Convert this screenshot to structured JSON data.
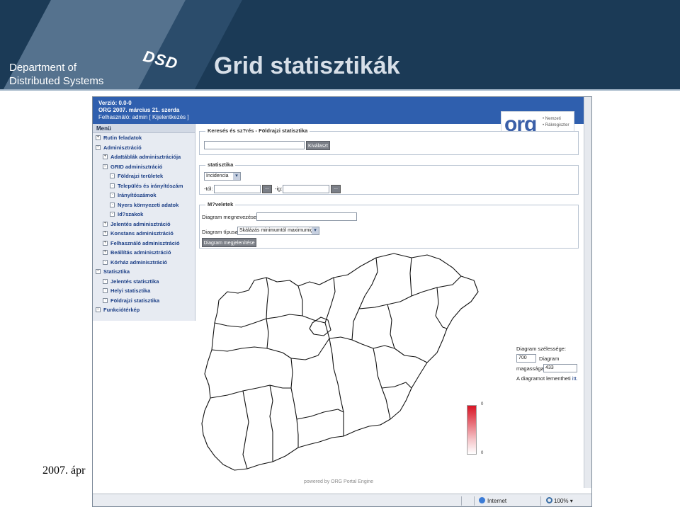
{
  "slide": {
    "dept_line1": "Department of",
    "dept_line2": "Distributed Systems",
    "logo_text": "DSD",
    "title": "Grid statisztikák",
    "footer_date": "2007. ápr"
  },
  "app": {
    "version": "Verzió: 0.0-0",
    "date_line": "ORG 2007. március 21. szerda",
    "user_line": "Felhasználó: admin [ Kijelentkezés ]",
    "logo_org": "org",
    "logo_sub1": "• Nemzeti",
    "logo_sub2": "• Rákregiszter"
  },
  "menu": {
    "header": "Menü",
    "items": [
      {
        "toggle": "+",
        "label": "Rutin feladatok",
        "indent": 0
      },
      {
        "toggle": "−",
        "label": "Adminisztráció",
        "indent": 0
      },
      {
        "toggle": "+",
        "label": "Adattáblák adminisztrációja",
        "indent": 1
      },
      {
        "toggle": "−",
        "label": "GRID adminisztráció",
        "indent": 1
      },
      {
        "toggle": "·",
        "label": "Földrajzi területek",
        "indent": 2
      },
      {
        "toggle": "·",
        "label": "Település és irányítószám",
        "indent": 2
      },
      {
        "toggle": "·",
        "label": "Irányítószámok",
        "indent": 2
      },
      {
        "toggle": "·",
        "label": "Nyers környezeti adatok",
        "indent": 2
      },
      {
        "toggle": "·",
        "label": "Id?szakok",
        "indent": 2
      },
      {
        "toggle": "+",
        "label": "Jelentés adminisztráció",
        "indent": 1
      },
      {
        "toggle": "+",
        "label": "Konstans adminisztráció",
        "indent": 1
      },
      {
        "toggle": "+",
        "label": "Felhasználó adminisztráció",
        "indent": 1
      },
      {
        "toggle": "+",
        "label": "Beállítás adminisztráció",
        "indent": 1
      },
      {
        "toggle": "·",
        "label": "Kórház adminisztráció",
        "indent": 1
      },
      {
        "toggle": "−",
        "label": "Statisztika",
        "indent": 0
      },
      {
        "toggle": "·",
        "label": "Jelentés statisztika",
        "indent": 1
      },
      {
        "toggle": "·",
        "label": "Helyi statisztika",
        "indent": 1
      },
      {
        "toggle": "·",
        "label": "Földrajzi statisztika",
        "indent": 1
      },
      {
        "toggle": "−",
        "label": "Funkciótérkép",
        "indent": 0
      }
    ]
  },
  "search": {
    "legend": "Keresés és sz?rés - Földrajzi statisztika",
    "value": "",
    "button": "Kiválaszt"
  },
  "stat": {
    "legend": "statisztika",
    "selected": "Incidencia",
    "from_label": "-tól:",
    "to_label": "-ig:",
    "dots": "..."
  },
  "ops": {
    "legend": "M?veletek",
    "name_label": "Diagram megnevezése:",
    "type_label": "Diagram típusa:",
    "type_value": "Skálázás minimumtól maximumig",
    "show_button": "Diagram megjelenítése"
  },
  "side": {
    "width_label": "Diagram szélessége:",
    "width_value": "700",
    "width_unit": "Diagram",
    "height_label": "magassága:",
    "height_value": "433",
    "save_text": "A diagramot lementheti",
    "save_link": "itt."
  },
  "legend_scale": {
    "max": "0",
    "min": "0"
  },
  "powered": "powered by ORG Portal Engine",
  "status": {
    "zone": "Internet",
    "zoom": "100%"
  }
}
